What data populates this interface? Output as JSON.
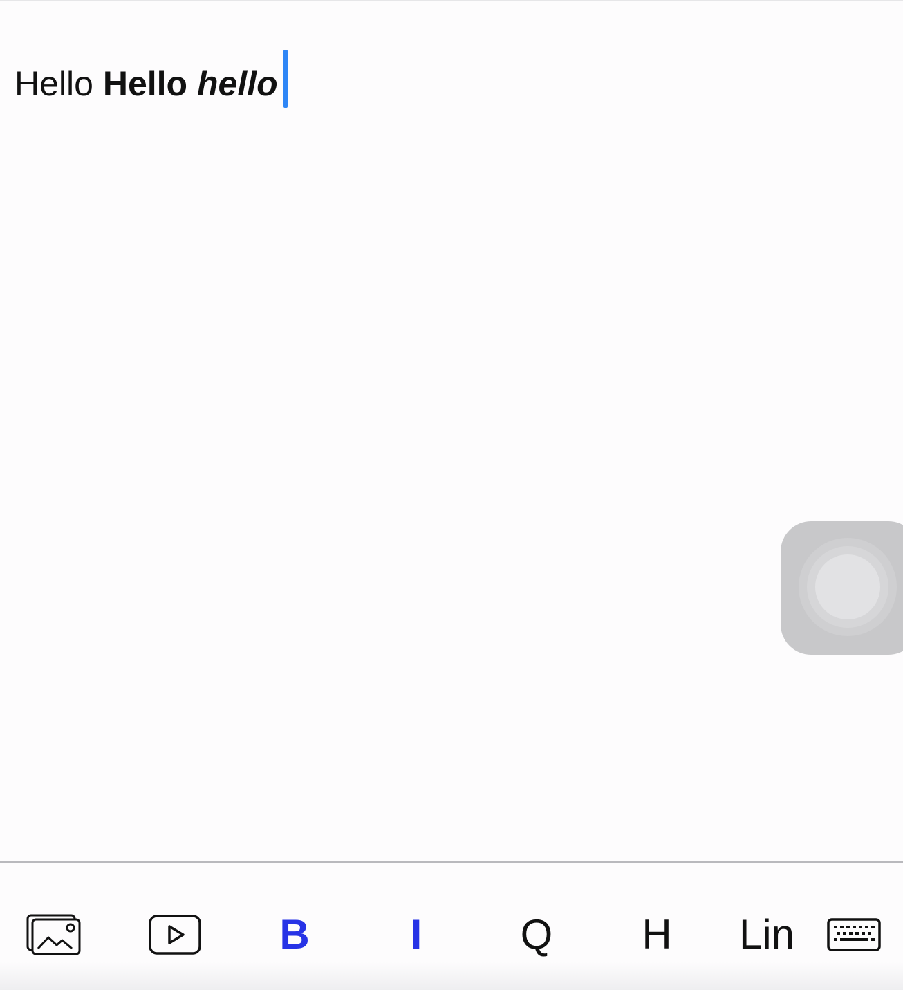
{
  "editor": {
    "segments": {
      "plain": "Hello",
      "bold": "Hello",
      "bold_italic": "hello"
    }
  },
  "toolbar": {
    "image_icon": "image-icon",
    "video_icon": "video-play-icon",
    "bold_label": "B",
    "italic_label": "I",
    "quote_label": "Q",
    "heading_label": "H",
    "link_label": "Lin",
    "keyboard_icon": "keyboard-icon",
    "active_color": "#2733e6"
  },
  "colors": {
    "caret": "#2f86f6",
    "text": "#111111",
    "background": "#fdfcfd"
  }
}
